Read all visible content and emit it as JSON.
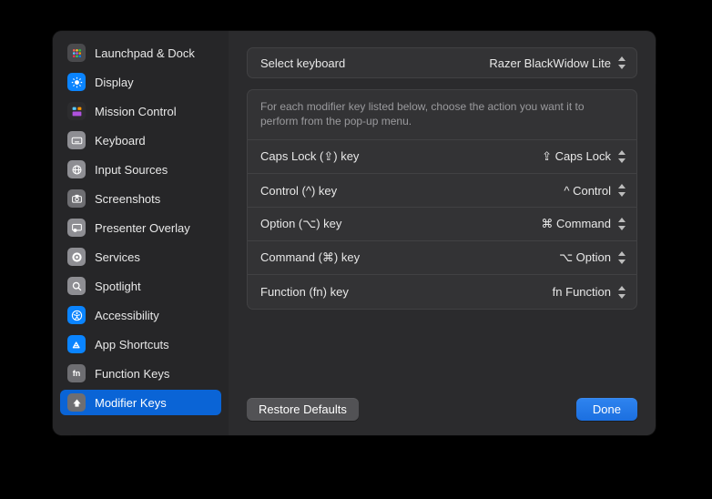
{
  "sidebar": {
    "items": [
      {
        "label": "Launchpad & Dock",
        "icon": "launchpad"
      },
      {
        "label": "Display",
        "icon": "display"
      },
      {
        "label": "Mission Control",
        "icon": "mission"
      },
      {
        "label": "Keyboard",
        "icon": "keyboard"
      },
      {
        "label": "Input Sources",
        "icon": "input"
      },
      {
        "label": "Screenshots",
        "icon": "screen"
      },
      {
        "label": "Presenter Overlay",
        "icon": "presenter"
      },
      {
        "label": "Services",
        "icon": "services"
      },
      {
        "label": "Spotlight",
        "icon": "spotlight"
      },
      {
        "label": "Accessibility",
        "icon": "access"
      },
      {
        "label": "App Shortcuts",
        "icon": "appshort"
      },
      {
        "label": "Function Keys",
        "icon": "fnkeys"
      },
      {
        "label": "Modifier Keys",
        "icon": "modkeys",
        "selected": true
      }
    ]
  },
  "keyboard_select": {
    "label": "Select keyboard",
    "value": "Razer BlackWidow Lite"
  },
  "help_text": "For each modifier key listed below, choose the action you want it to perform from the pop-up menu.",
  "rows": [
    {
      "label": "Caps Lock (⇪) key",
      "value": "⇪ Caps Lock"
    },
    {
      "label": "Control (^) key",
      "value": "^ Control"
    },
    {
      "label": "Option (⌥) key",
      "value": "⌘ Command"
    },
    {
      "label": "Command (⌘) key",
      "value": "⌥ Option"
    },
    {
      "label": "Function (fn) key",
      "value": "fn Function"
    }
  ],
  "footer": {
    "restore": "Restore Defaults",
    "done": "Done"
  }
}
